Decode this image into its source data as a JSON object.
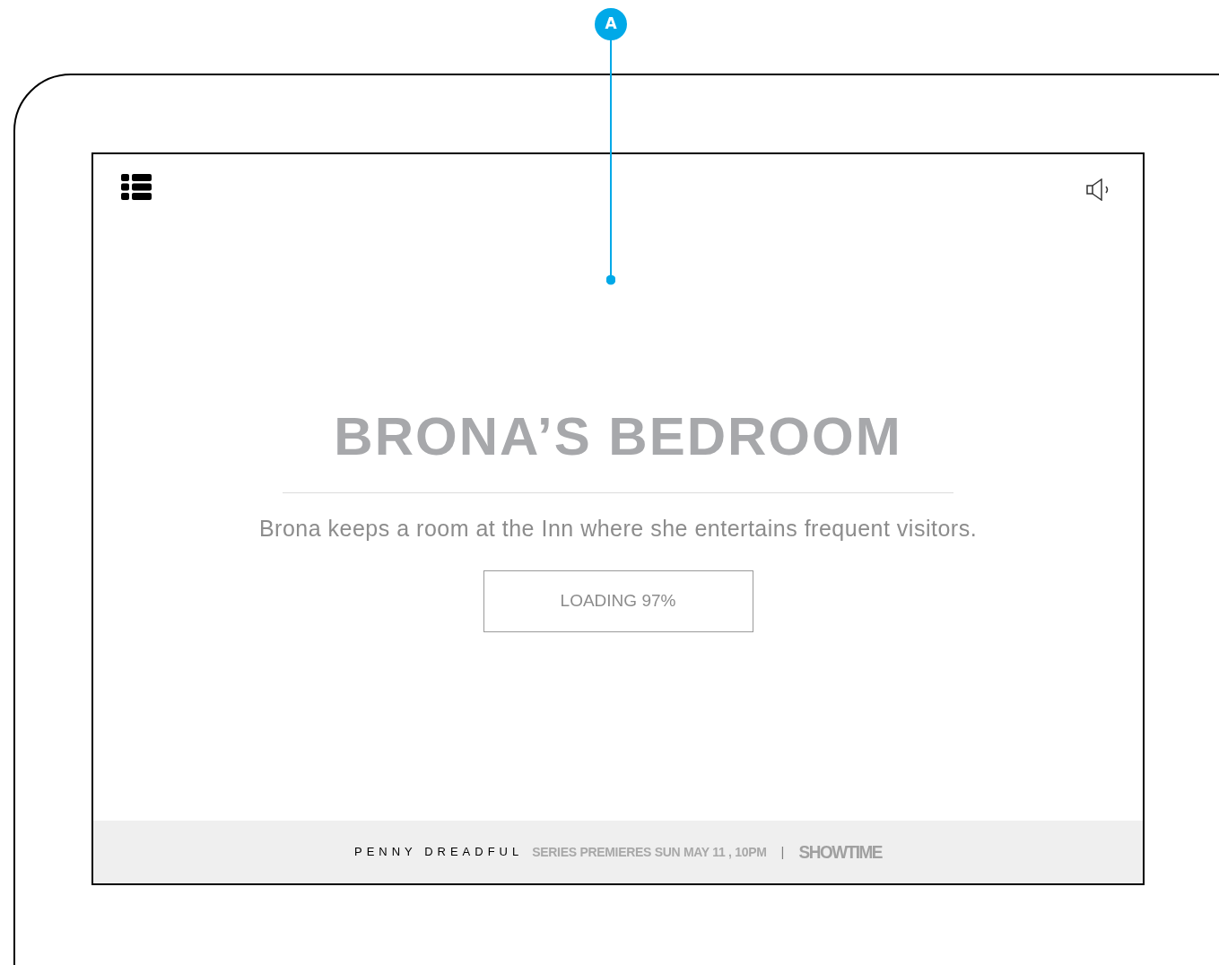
{
  "annotation": {
    "label": "A"
  },
  "screen": {
    "title": "BRONA’S BEDROOM",
    "description": "Brona keeps a room at the Inn where she entertains frequent visitors.",
    "loading_button": "LOADING 97%"
  },
  "footer": {
    "show": "PENNY DREADFUL",
    "premiere": "SERIES PREMIERES SUN MAY 11 , 10PM",
    "separator": "|",
    "network_logo": "SHOWTIME"
  }
}
